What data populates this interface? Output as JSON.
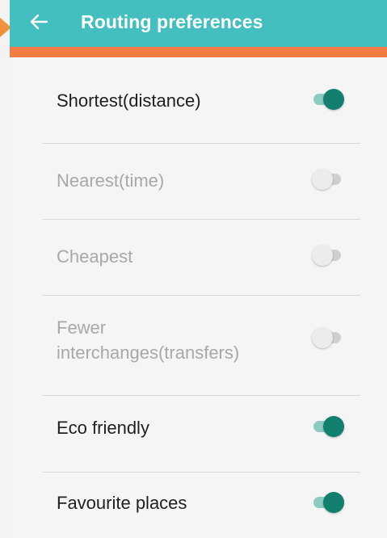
{
  "header": {
    "title": "Routing preferences",
    "back_icon": "arrow-left-icon"
  },
  "colors": {
    "appbar": "#43bfbf",
    "accent_stripe": "#f17d45",
    "toggle_on": "#127f6f",
    "toggle_off": "#ececec"
  },
  "preferences": [
    {
      "label": "Shortest(distance)",
      "enabled": true
    },
    {
      "label": "Nearest(time)",
      "enabled": false
    },
    {
      "label": "Cheapest",
      "enabled": false
    },
    {
      "label": "Fewer\ninterchanges(transfers)",
      "enabled": false
    },
    {
      "label": "Eco friendly",
      "enabled": true
    },
    {
      "label": "Favourite places",
      "enabled": true
    }
  ]
}
